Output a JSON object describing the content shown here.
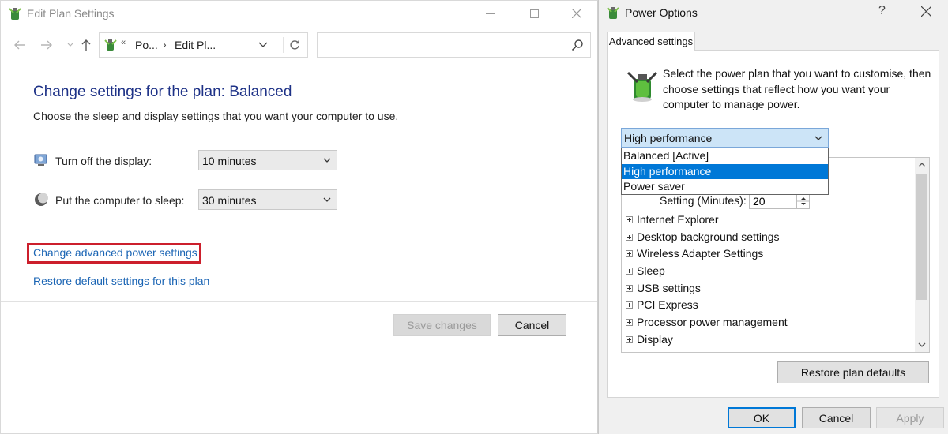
{
  "left_window": {
    "title": "Edit Plan Settings",
    "address": {
      "sep1": "«",
      "segment1": "Po...",
      "sep2": "›",
      "segment2": "Edit Pl..."
    },
    "search": {
      "placeholder": ""
    },
    "heading": "Change settings for the plan: Balanced",
    "subheading": "Choose the sleep and display settings that you want your computer to use.",
    "display_setting": {
      "label": "Turn off the display:",
      "value": "10 minutes"
    },
    "sleep_setting": {
      "label": "Put the computer to sleep:",
      "value": "30 minutes"
    },
    "links": {
      "advanced": "Change advanced power settings",
      "restore": "Restore default settings for this plan"
    },
    "buttons": {
      "save": "Save changes",
      "cancel": "Cancel"
    }
  },
  "right_window": {
    "title": "Power Options",
    "help": "?",
    "tab": "Advanced settings",
    "intro": "Select the power plan that you want to customise, then choose settings that reflect how you want your computer to manage power.",
    "plan_selected": "High performance",
    "plan_options": [
      "Balanced [Active]",
      "High performance",
      "Power saver"
    ],
    "setting_row": {
      "label": "Setting (Minutes):",
      "value": "20"
    },
    "tree_items": [
      "Internet Explorer",
      "Desktop background settings",
      "Wireless Adapter Settings",
      "Sleep",
      "USB settings",
      "PCI Express",
      "Processor power management",
      "Display"
    ],
    "buttons": {
      "restore_defaults": "Restore plan defaults",
      "ok": "OK",
      "cancel": "Cancel",
      "apply": "Apply"
    }
  },
  "colors": {
    "heading_blue": "#1e3287",
    "link_blue": "#1a64b4",
    "highlight_red": "#cc1f2c",
    "selection_blue": "#0078d7"
  }
}
